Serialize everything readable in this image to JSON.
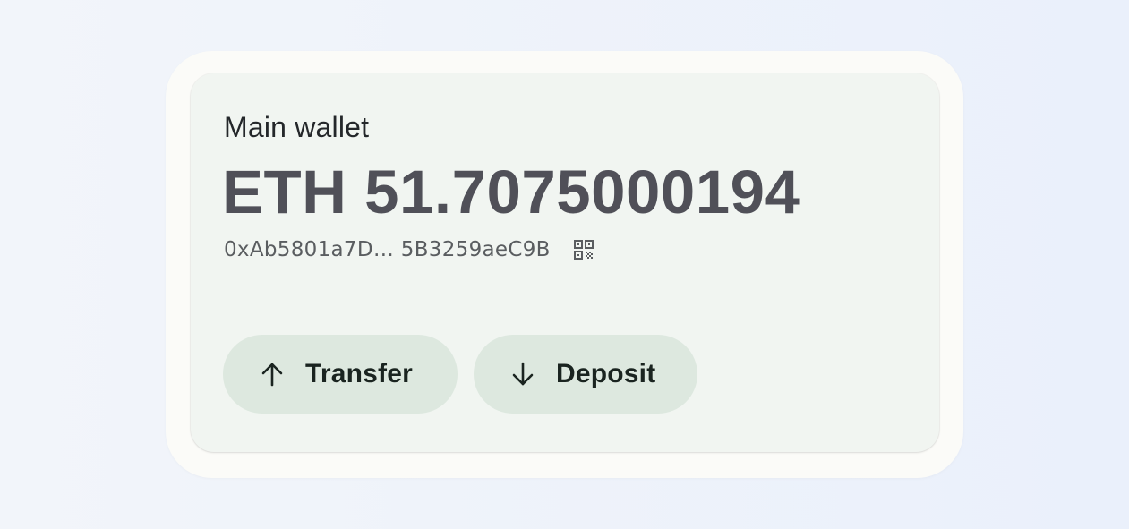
{
  "wallet": {
    "name": "Main wallet",
    "balance": "ETH 51.7075000194",
    "address": "0xAb5801a7D… 5B3259aeC9B",
    "qr_icon": "qr-code-icon"
  },
  "actions": {
    "transfer": {
      "label": "Transfer",
      "icon": "arrow-up-icon"
    },
    "deposit": {
      "label": "Deposit",
      "icon": "arrow-down-icon"
    }
  },
  "colors": {
    "card_background": "#f1f5f1",
    "button_background": "#dde8df",
    "balance_text": "#505058"
  }
}
